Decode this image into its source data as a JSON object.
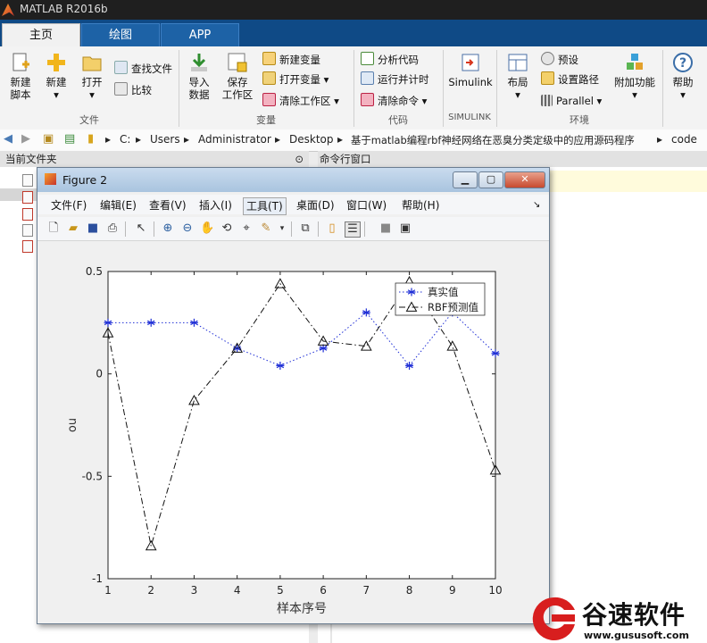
{
  "app": {
    "title": "MATLAB R2016b"
  },
  "ribbon_tabs": [
    {
      "label": "主页",
      "active": true
    },
    {
      "label": "绘图",
      "active": false
    },
    {
      "label": "APP",
      "active": false
    }
  ],
  "ribbon": {
    "file": {
      "new_script": "新建\n脚本",
      "new": "新建",
      "open": "打开",
      "find_files": "查找文件",
      "compare": "比较",
      "group": "文件"
    },
    "variable": {
      "import_data": "导入\n数据",
      "save_workspace": "保存\n工作区",
      "new_variable": "新建变量",
      "open_variable": "打开变量",
      "clear_workspace": "清除工作区",
      "group": "变量"
    },
    "code": {
      "analyze_code": "分析代码",
      "run_and_time": "运行并计时",
      "clear_commands": "清除命令",
      "group": "代码"
    },
    "simulink": {
      "label": "Simulink",
      "group": "SIMULINK"
    },
    "env": {
      "layout": "布局",
      "preferences": "预设",
      "set_path": "设置路径",
      "parallel": "Parallel",
      "addons": "附加功能",
      "group": "环境"
    },
    "help": "帮助"
  },
  "address": {
    "crumbs": [
      "C:",
      "Users",
      "Administrator",
      "Desktop",
      "基于matlab编程rbf神经网络在恶臭分类定级中的应用源码程序",
      "code"
    ]
  },
  "panels": {
    "current_folder": "当前文件夹",
    "command_window": "命令行窗口"
  },
  "figure": {
    "title": "Figure 2",
    "menus": [
      "文件(F)",
      "编辑(E)",
      "查看(V)",
      "插入(I)",
      "工具(T)",
      "桌面(D)",
      "窗口(W)",
      "帮助(H)"
    ],
    "highlighted_menu": "工具(T)"
  },
  "chart_data": {
    "type": "line",
    "x": [
      1,
      2,
      3,
      4,
      5,
      6,
      7,
      8,
      9,
      10
    ],
    "series": [
      {
        "name": "真实值",
        "values": [
          0.25,
          0.25,
          0.25,
          0.125,
          0.04,
          0.125,
          0.3,
          0.04,
          0.3,
          0.1
        ],
        "color": "#1f2fd6",
        "marker": "asterisk",
        "line": "dotted"
      },
      {
        "name": "RBF预测值",
        "values": [
          0.2,
          -0.84,
          -0.13,
          0.125,
          0.44,
          0.16,
          0.135,
          0.45,
          0.135,
          -0.47
        ],
        "color": "#111111",
        "marker": "triangle",
        "line": "dash-dot"
      }
    ],
    "xlabel": "样本序号",
    "ylabel": "ou",
    "xlim": [
      1,
      10
    ],
    "ylim": [
      -1,
      0.5
    ],
    "xticks": [
      "1",
      "2",
      "3",
      "4",
      "5",
      "6",
      "7",
      "8",
      "9",
      "10"
    ],
    "yticks": [
      "-1",
      "-0.5",
      "0",
      "0.5"
    ],
    "grid": false,
    "legend": "top-right"
  },
  "watermark": {
    "brand": "谷速软件",
    "url": "www.gususoft.com",
    "color": "#d81e1e"
  }
}
